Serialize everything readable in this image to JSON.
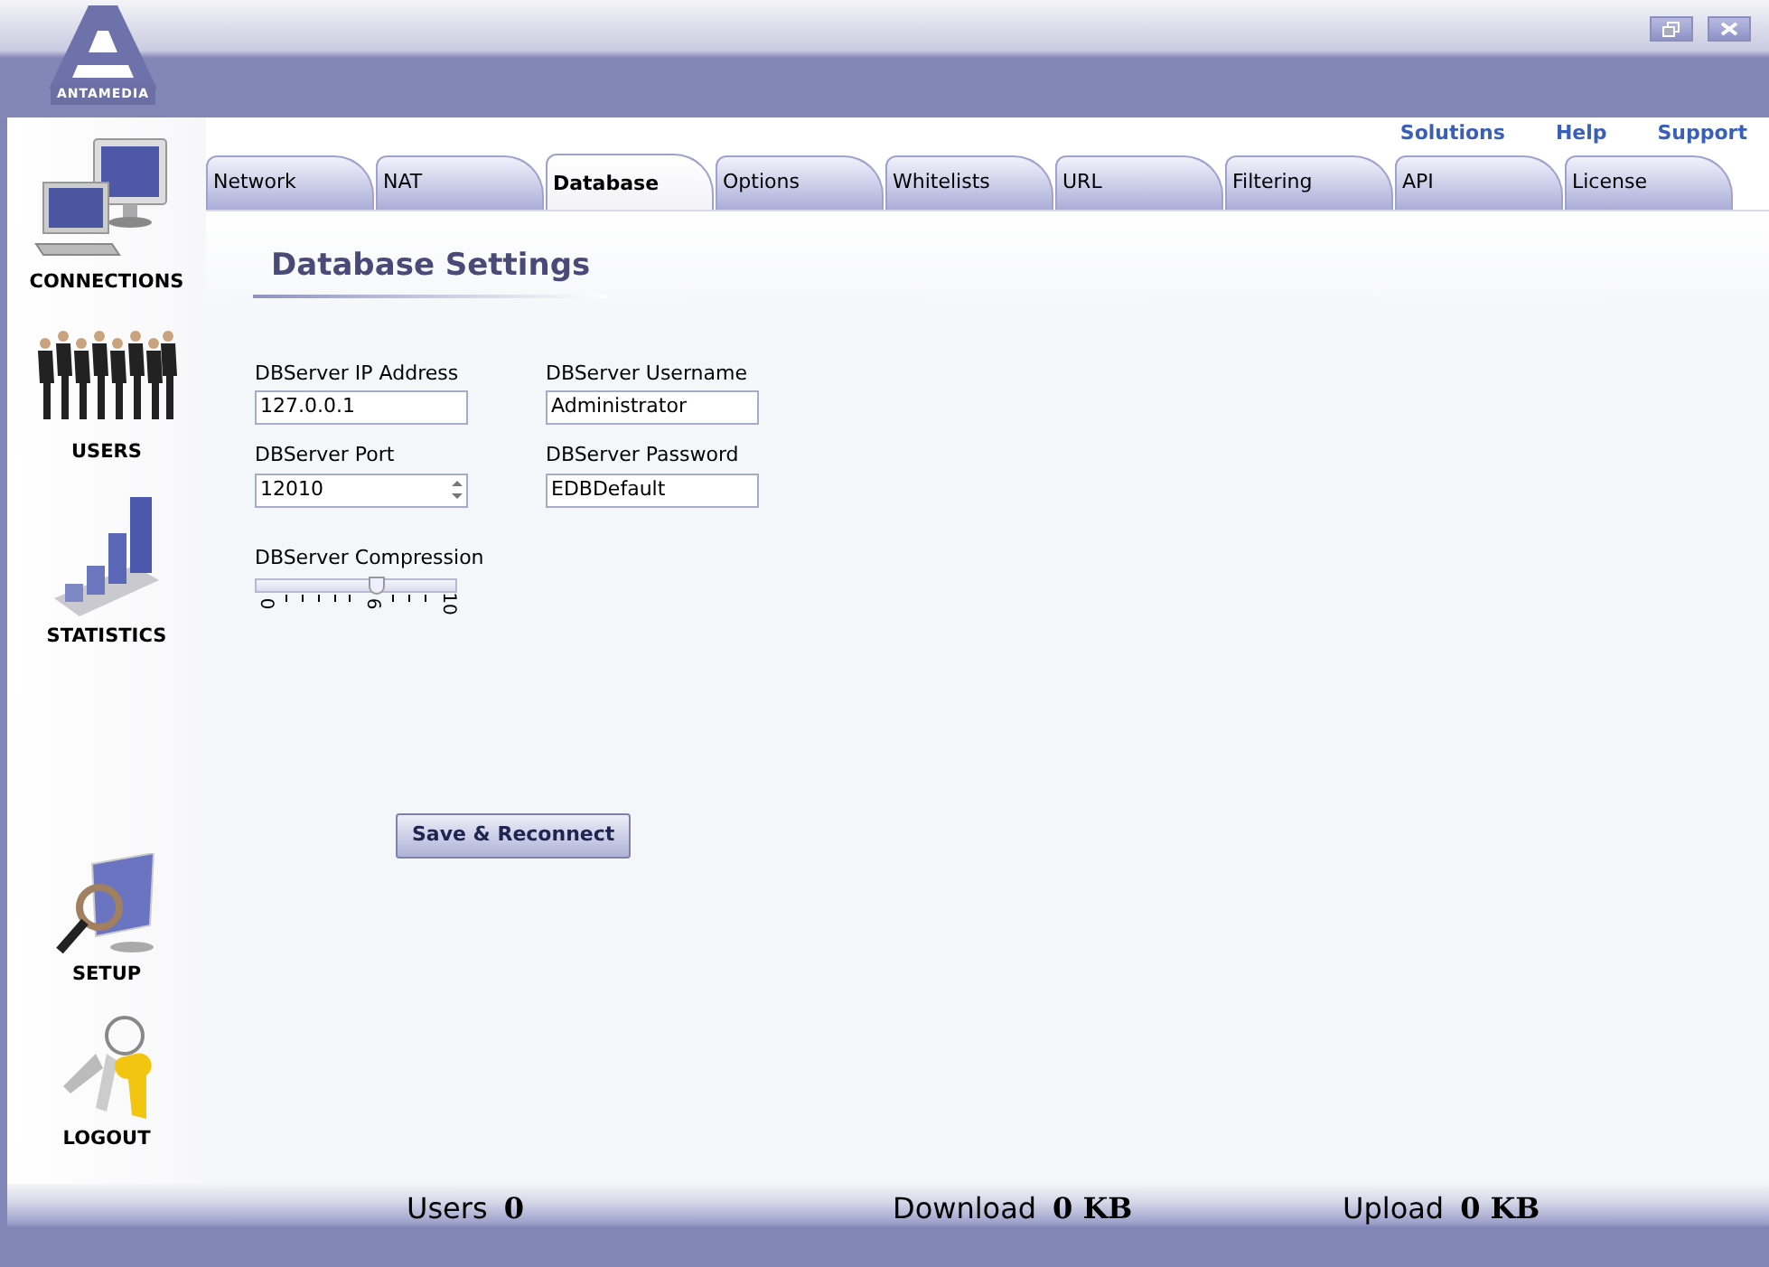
{
  "logo": {
    "text": "ANTAMEDIA"
  },
  "window_buttons": [
    {
      "kind": "restore"
    },
    {
      "kind": "close"
    }
  ],
  "links": [
    "Solutions",
    "Help",
    "Support"
  ],
  "sidebar": {
    "items": [
      {
        "label": "CONNECTIONS",
        "kind": "connections"
      },
      {
        "label": "USERS",
        "kind": "users"
      },
      {
        "label": "STATISTICS",
        "kind": "statistics"
      }
    ],
    "bottom_items": [
      {
        "label": "SETUP",
        "kind": "setup"
      },
      {
        "label": "LOGOUT",
        "kind": "logout"
      }
    ]
  },
  "tabs": [
    {
      "label": "Network",
      "selected": false
    },
    {
      "label": "NAT",
      "selected": false
    },
    {
      "label": "Database",
      "selected": true
    },
    {
      "label": "Options",
      "selected": false
    },
    {
      "label": "Whitelists",
      "selected": false
    },
    {
      "label": "URL",
      "selected": false
    },
    {
      "label": "Filtering",
      "selected": false
    },
    {
      "label": "API",
      "selected": false
    },
    {
      "label": "License",
      "selected": false
    }
  ],
  "section_title": "Database Settings",
  "fields": [
    {
      "label": "DBServer IP Address",
      "value": "127.0.0.1",
      "kind": "text"
    },
    {
      "label": "DBServer Username",
      "value": "Administrator",
      "kind": "text"
    },
    {
      "label": "DBServer Port",
      "value": "12010",
      "kind": "spin"
    },
    {
      "label": "DBServer Password",
      "value": "EDBDefault",
      "kind": "text"
    }
  ],
  "compression": {
    "label": "DBServer Compression",
    "level": 0.6,
    "tick_labels": [
      "0",
      "6",
      "10"
    ]
  },
  "save_button": "Save & Reconnect",
  "status_bar": [
    {
      "label": "Users",
      "value": "0"
    },
    {
      "label": "Download",
      "value": "0 KB"
    },
    {
      "label": "Upload",
      "value": "0 KB"
    }
  ]
}
